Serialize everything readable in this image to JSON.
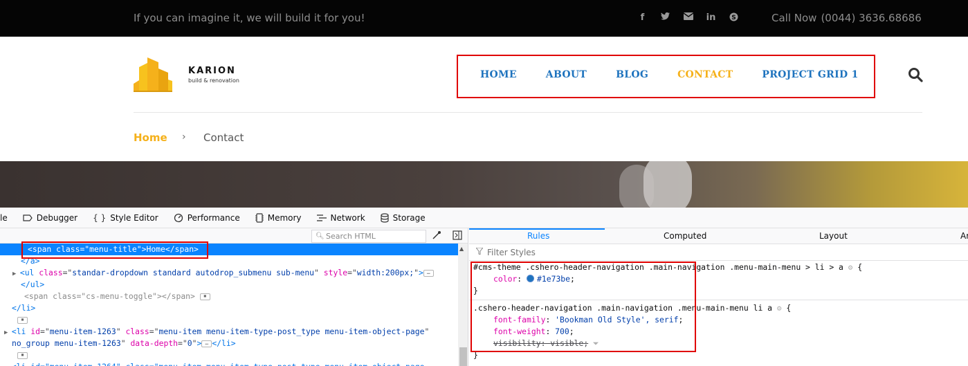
{
  "site": {
    "tagline": "If you can imagine it, we will build it for you!",
    "socials": [
      "facebook-icon",
      "twitter-icon",
      "email-icon",
      "linkedin-icon",
      "skype-icon"
    ],
    "call_label": "Call Now",
    "call_number": "(0044) 3636.68686",
    "brand": "KARION",
    "brand_sub": "build & renovation",
    "nav": [
      "HOME",
      "ABOUT",
      "BLOG",
      "CONTACT",
      "PROJECT GRID 1"
    ],
    "nav_active_index": 3,
    "breadcrumb": {
      "home": "Home",
      "separator": "›",
      "current": "Contact"
    },
    "colors": {
      "nav_link": "#1e73be",
      "accent": "#f5b11b",
      "highlight_box": "#e00000"
    }
  },
  "devtools": {
    "tabs": [
      {
        "icon": "",
        "label": "le"
      },
      {
        "icon": "debugger-icon",
        "label": "Debugger"
      },
      {
        "icon": "style-editor-icon",
        "label": "Style Editor"
      },
      {
        "icon": "performance-icon",
        "label": "Performance"
      },
      {
        "icon": "memory-icon",
        "label": "Memory"
      },
      {
        "icon": "network-icon",
        "label": "Network"
      },
      {
        "icon": "storage-icon",
        "label": "Storage"
      }
    ],
    "search_placeholder": "Search HTML",
    "html_lines": [
      {
        "k": "span",
        "tag": "span",
        "attrs": [
          [
            "class",
            "menu-title"
          ]
        ],
        "text": "Home"
      },
      {
        "k": "close",
        "tag": "a"
      },
      {
        "k": "ul",
        "tag": "ul",
        "attrs": [
          [
            "class",
            "standar-dropdown standard autodrop_submenu sub-menu"
          ],
          [
            "style",
            "width:200px;"
          ]
        ]
      },
      {
        "k": "close",
        "tag": "ul"
      },
      {
        "k": "span-muted",
        "tag": "span",
        "attrs": [
          [
            "class",
            "cs-menu-toggle"
          ]
        ]
      },
      {
        "k": "close",
        "tag": "li"
      },
      {
        "k": "event"
      },
      {
        "k": "li",
        "tag": "li",
        "attrs": [
          [
            "id",
            "menu-item-1263"
          ],
          [
            "class",
            "menu-item menu-item-type-post_type menu-item-object-page"
          ]
        ]
      },
      {
        "k": "cont",
        "text_attrs": "no_group menu-item-1263",
        "last_attr": [
          "data-depth",
          "0"
        ]
      },
      {
        "k": "event"
      },
      {
        "k": "li-partial",
        "text": "<li id=\"menu-item-1264\" class=\"menu-item menu-item-type-post_type menu-item-object-page"
      }
    ],
    "rules_tabs": [
      "Rules",
      "Computed",
      "Layout",
      "Ar"
    ],
    "filter_placeholder": "Filter Styles",
    "rules": [
      {
        "selector": "#cms-theme .cshero-header-navigation .main-navigation .menu-main-menu > li > a",
        "props": [
          {
            "name": "color",
            "value": "#1e73be",
            "swatch": true
          }
        ]
      },
      {
        "selector": ".cshero-header-navigation .main-navigation .menu-main-menu li a",
        "props": [
          {
            "name": "font-family",
            "value": "'Bookman Old Style', serif"
          },
          {
            "name": "font-weight",
            "value": "700"
          },
          {
            "name": "visibility",
            "value": "visible",
            "overridden": true
          }
        ]
      }
    ]
  }
}
